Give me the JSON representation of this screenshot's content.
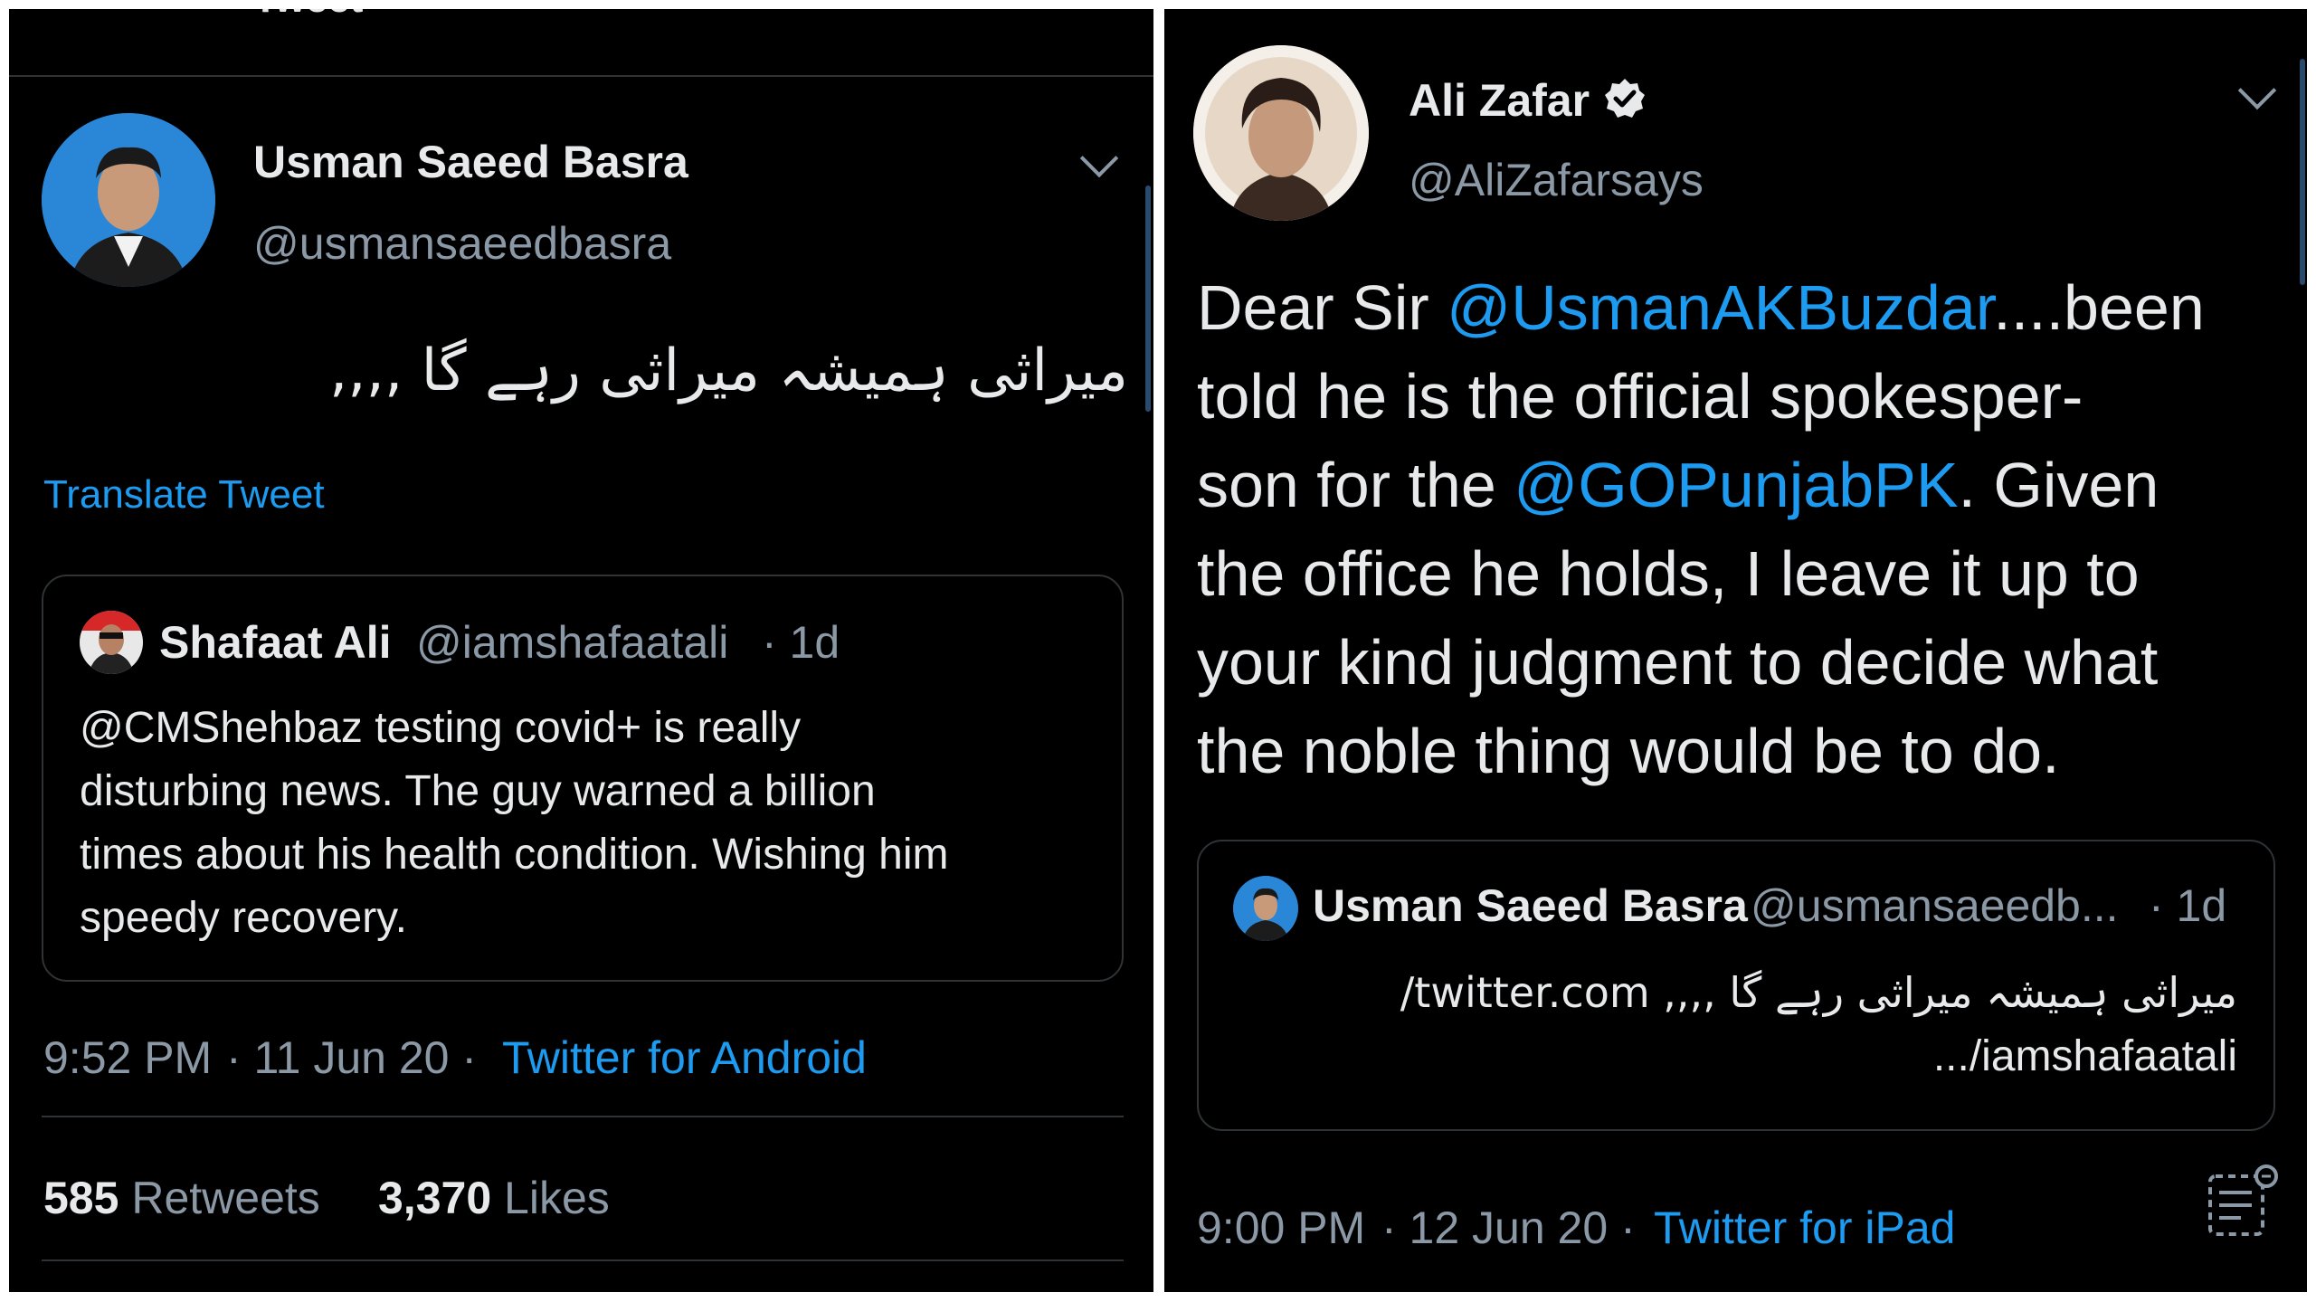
{
  "left_tweet": {
    "header_partial": "Tweet",
    "author_name": "Usman Saeed Basra",
    "author_handle": "@usmansaeedbasra",
    "body_urdu": "میراثی ہمیشہ میراثی رہے گا ,,,,",
    "translate_label": "Translate Tweet",
    "quote": {
      "author_name": "Shafaat Ali",
      "author_handle": "@iamshafaatali",
      "age": "· 1d",
      "lines": [
        "@CMShehbaz testing covid+ is really",
        "disturbing news. The guy warned a billion",
        "times about his health condition. Wishing him",
        "speedy recovery."
      ]
    },
    "time": "9:52 PM",
    "date": "· 11 Jun 20 ·",
    "source": "Twitter for Android",
    "retweets_count": "585",
    "retweets_label": "Retweets",
    "likes_count": "3,370",
    "likes_label": "Likes"
  },
  "right_tweet": {
    "author_name": "Ali Zafar",
    "author_handle": "@AliZafarsays",
    "verified": true,
    "body": {
      "l1_a": "Dear Sir ",
      "l1_mention": "@UsmanAKBuzdar",
      "l1_b": "....been",
      "l2": "told he is the official spokesper-",
      "l3_a": "son for the ",
      "l3_mention": "@GOPunjabPK",
      "l3_b": ". Given",
      "l4": "the office he holds, I leave it up to",
      "l5": "your kind judgment to decide what",
      "l6": "the noble thing would be to do."
    },
    "quote": {
      "author_name": "Usman Saeed Basra",
      "author_handle": "@usmansaeedb...",
      "age": "· 1d",
      "line1_urdu": "میراثی ہمیشہ میراثی رہے گا ,,,,",
      "line1_link": "twitter.com/",
      "line2": ".../iamshafaatali"
    },
    "time": "9:00 PM",
    "date": "· 12 Jun 20 ·",
    "source": "Twitter for iPad"
  },
  "colors": {
    "background": "#000000",
    "text": "#e7e9ea",
    "secondary": "#8b98a5",
    "link": "#1d9bf0",
    "border": "#2f3336"
  },
  "icons": [
    "chevron-down-icon",
    "verified-badge-icon",
    "tweet-analytics-icon"
  ]
}
